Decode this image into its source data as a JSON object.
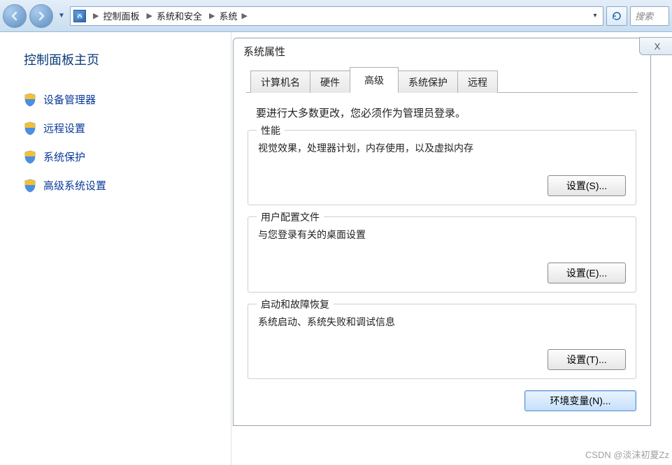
{
  "nav": {
    "breadcrumb": [
      "控制面板",
      "系统和安全",
      "系统"
    ],
    "search_placeholder": "搜索"
  },
  "sidebar": {
    "title": "控制面板主页",
    "items": [
      {
        "label": "设备管理器"
      },
      {
        "label": "远程设置"
      },
      {
        "label": "系统保护"
      },
      {
        "label": "高级系统设置"
      }
    ]
  },
  "dialog": {
    "title": "系统属性",
    "close_text": "X",
    "tabs": [
      {
        "label": "计算机名"
      },
      {
        "label": "硬件"
      },
      {
        "label": "高级",
        "active": true
      },
      {
        "label": "系统保护"
      },
      {
        "label": "远程"
      }
    ],
    "admin_note": "要进行大多数更改，您必须作为管理员登录。",
    "groups": [
      {
        "legend": "性能",
        "desc": "视觉效果，处理器计划，内存使用，以及虚拟内存",
        "button": "设置(S)..."
      },
      {
        "legend": "用户配置文件",
        "desc": "与您登录有关的桌面设置",
        "button": "设置(E)..."
      },
      {
        "legend": "启动和故障恢复",
        "desc": "系统启动、系统失败和调试信息",
        "button": "设置(T)..."
      }
    ],
    "env_button": "环境变量(N)..."
  },
  "watermark": "CSDN @淡沫初夏Zz"
}
